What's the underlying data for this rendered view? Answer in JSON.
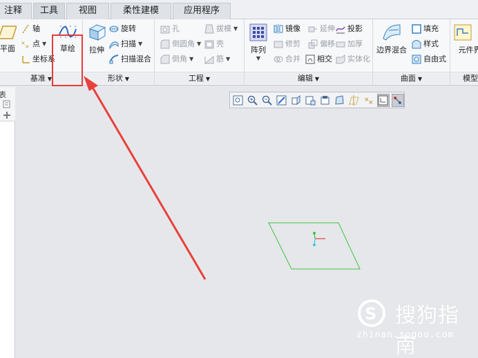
{
  "tabs": [
    {
      "label": "注释"
    },
    {
      "label": "工具"
    },
    {
      "label": "视图"
    },
    {
      "label": "柔性建模"
    },
    {
      "label": "应用程序"
    }
  ],
  "ribbon": {
    "datum": {
      "label": "基准",
      "plane": "平面",
      "axis": "轴",
      "point": "点",
      "csys": "坐标系",
      "sketch": "草绘"
    },
    "shapes": {
      "label": "形状",
      "extrude": "拉伸",
      "revolve": "旋转",
      "sweep": "扫描",
      "swept_blend": "扫描混合"
    },
    "engineering": {
      "label": "工程",
      "hole": "孔",
      "round": "倒圆角",
      "chamfer": "倒角",
      "draft": "拔模",
      "shell": "壳",
      "rib": "筋"
    },
    "editing": {
      "label": "编辑",
      "pattern": "阵列",
      "mirror": "镜像",
      "trim": "修剪",
      "merge": "合并",
      "extend": "延伸",
      "offset": "偏移",
      "intersect": "相交",
      "project": "投影",
      "thicken": "加厚",
      "solidify": "实体化"
    },
    "surfaces": {
      "label": "曲面",
      "boundary_blend": "边界混合",
      "fill": "填充",
      "style": "样式",
      "freestyle": "自由式"
    },
    "model_intent": {
      "label": "模型意图",
      "component_interface": "元件界"
    }
  },
  "left_panel": {
    "tab": "表"
  },
  "watermark": {
    "brand": "搜狗指南",
    "url": "zhinan.sogou.com"
  },
  "colors": {
    "highlight": "#e33b3b",
    "datum_plane": "#3cc43c",
    "accent_blue": "#2a6ac8"
  }
}
